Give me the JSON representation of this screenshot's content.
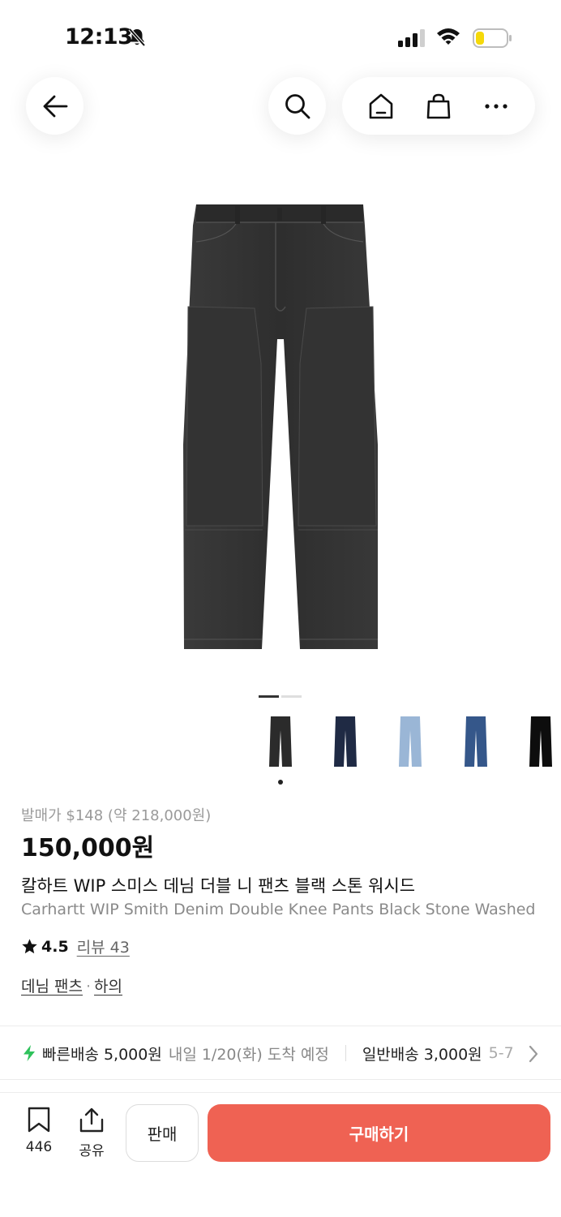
{
  "status_bar": {
    "time": "12:13"
  },
  "product": {
    "release_price": "발매가 $148 (약 218,000원)",
    "price": "150,000원",
    "title_kr": "칼하트 WIP 스미스 데님 더블 니 팬츠 블랙 스톤 워시드",
    "title_en": "Carhartt WIP Smith Denim Double Knee Pants Black Stone Washed",
    "rating": "4.5",
    "review_label": "리뷰 43",
    "category_main": "데님 팬츠",
    "category_separator": "·",
    "category_sub": "하의"
  },
  "thumbnails": [
    {
      "icon": "black-stone-washed-jeans",
      "color": "#2b2b2b"
    },
    {
      "icon": "dark-navy-jeans",
      "color": "#1f2a44"
    },
    {
      "icon": "light-blue-jeans",
      "color": "#9ab6d6"
    },
    {
      "icon": "mid-blue-jeans",
      "color": "#35578a"
    },
    {
      "icon": "black-jeans",
      "color": "#0d0d0d"
    }
  ],
  "image_indicator": {
    "current": 1,
    "total": 2
  },
  "shipping": {
    "fast_label": "빠른배송 5,000원",
    "fast_date": "내일 1/20(화) 도착 예정",
    "normal_label": "일반배송 3,000원",
    "normal_date": "5-7"
  },
  "bottom_bar": {
    "wish_count": "446",
    "share_label": "공유",
    "sell_label": "판매",
    "buy_label": "구매하기"
  },
  "colors": {
    "accent": "#ef6253",
    "fast_bolt": "#2fc25b"
  }
}
